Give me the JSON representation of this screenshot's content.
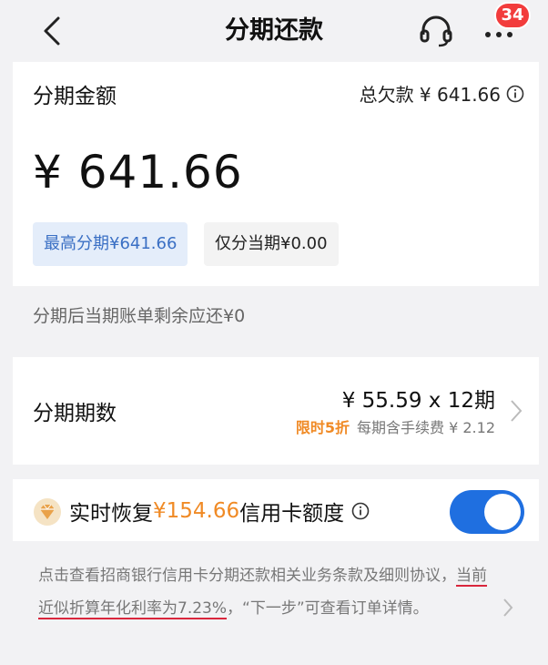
{
  "header": {
    "title": "分期还款",
    "badge": "34"
  },
  "amount_card": {
    "label": "分期金额",
    "total_debt": "总欠款 ¥ 641.66",
    "amount": "¥ 641.66",
    "chips": [
      {
        "label": "最高分期¥641.66",
        "selected": true
      },
      {
        "label": "仅分当期¥0.00",
        "selected": false
      }
    ]
  },
  "remaining_note": "分期后当期账单剩余应还¥0",
  "period_card": {
    "label": "分期期数",
    "value": "¥ 55.59 x 12期",
    "discount": "限时5折",
    "fee": "每期含手续费 ¥ 2.12"
  },
  "recover_card": {
    "prefix": "实时恢复",
    "amount": "¥154.66",
    "suffix": "信用卡额度",
    "toggle_on": true
  },
  "terms": {
    "part1": "点击查看招商银行信用卡分期还款相关业务条款及细则协议，",
    "rate": "当前近似折算年化利率为7.23%",
    "part2": "，“下一步”可查看订单详情。"
  },
  "colors": {
    "accent": "#1f6fe0",
    "orange": "#f08a25",
    "badge": "#f23c3c",
    "underline": "#d9263c"
  }
}
